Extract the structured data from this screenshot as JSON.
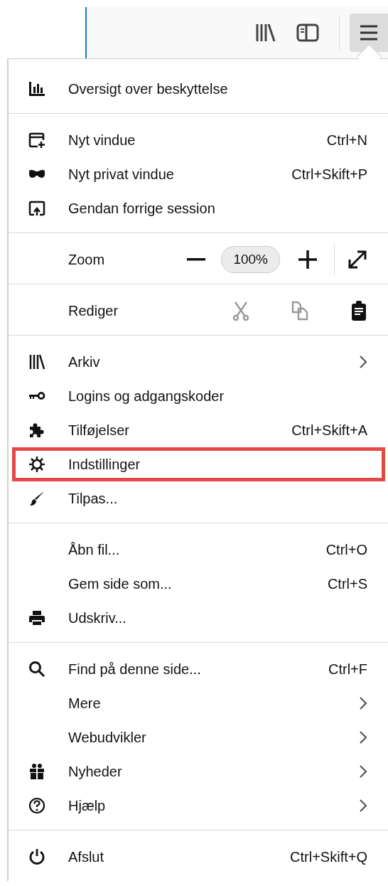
{
  "sections": [
    {
      "items": [
        {
          "kind": "item",
          "label": "Oversigt over beskyttelse",
          "highlighted": false
        }
      ]
    },
    {
      "items": [
        {
          "kind": "item",
          "label": "Nyt vindue",
          "shortcut": "Ctrl+N",
          "highlighted": false
        },
        {
          "kind": "item",
          "label": "Nyt privat vindue",
          "shortcut": "Ctrl+Skift+P",
          "highlighted": false
        },
        {
          "kind": "item",
          "label": "Gendan forrige session",
          "highlighted": false
        }
      ]
    },
    {
      "items": [
        {
          "kind": "zoom",
          "label": "Zoom",
          "value": "100%"
        }
      ]
    },
    {
      "items": [
        {
          "kind": "edit",
          "label": "Rediger",
          "buttons": [
            {
              "disabled": true
            },
            {
              "disabled": true
            },
            {
              "disabled": false
            }
          ]
        }
      ]
    },
    {
      "items": [
        {
          "kind": "item",
          "label": "Arkiv",
          "submenu": true,
          "highlighted": false
        },
        {
          "kind": "item",
          "label": "Logins og adgangskoder",
          "highlighted": false
        },
        {
          "kind": "item",
          "label": "Tilføjelser",
          "shortcut": "Ctrl+Skift+A",
          "highlighted": false
        },
        {
          "kind": "item",
          "label": "Indstillinger",
          "highlighted": true
        },
        {
          "kind": "item",
          "label": "Tilpas...",
          "highlighted": false
        }
      ]
    },
    {
      "items": [
        {
          "kind": "item",
          "label": "Åbn fil...",
          "shortcut": "Ctrl+O",
          "highlighted": false
        },
        {
          "kind": "item",
          "label": "Gem side som...",
          "shortcut": "Ctrl+S",
          "highlighted": false
        },
        {
          "kind": "item",
          "label": "Udskriv...",
          "highlighted": false
        }
      ]
    },
    {
      "items": [
        {
          "kind": "item",
          "label": "Find på denne side...",
          "shortcut": "Ctrl+F",
          "highlighted": false
        },
        {
          "kind": "item",
          "label": "Mere",
          "submenu": true,
          "highlighted": false
        },
        {
          "kind": "item",
          "label": "Webudvikler",
          "submenu": true,
          "highlighted": false
        },
        {
          "kind": "item",
          "label": "Nyheder",
          "submenu": true,
          "highlighted": false
        },
        {
          "kind": "item",
          "label": "Hjælp",
          "submenu": true,
          "highlighted": false
        }
      ]
    },
    {
      "items": [
        {
          "kind": "item",
          "label": "Afslut",
          "shortcut": "Ctrl+Skift+Q",
          "highlighted": false
        }
      ]
    }
  ]
}
